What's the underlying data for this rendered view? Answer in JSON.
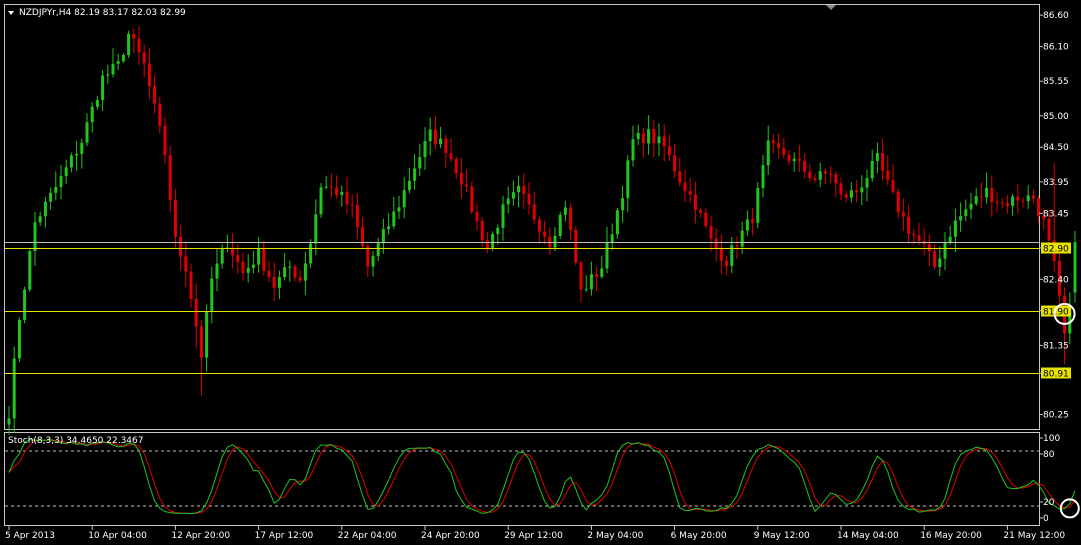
{
  "header": {
    "symbol_line": "NZDJPYr,H4  82.19 83.17 82.03 82.99",
    "indicator_line": "Stoch(8,3,3) 34.4650 22.3467"
  },
  "colors": {
    "background": "#000000",
    "bull": "#22C51E",
    "bear": "#E00000",
    "frame": "#C8C8C8",
    "level_line": "#E6E200",
    "bid_line": "#BEBEBE",
    "stoch_main": "#22C51E",
    "stoch_signal": "#E00000",
    "marker": "#FFFFFF",
    "arrow": "#22E21E"
  },
  "icons": [
    "dropdown-triangle-icon",
    "chart-shift-triangle-icon"
  ],
  "chart_data": [
    {
      "type": "candlestick",
      "symbol": "NZDJPYr",
      "timeframe": "H4",
      "last_bar": {
        "open": 82.19,
        "high": 83.17,
        "low": 82.03,
        "close": 82.99
      },
      "ylim": [
        80.1,
        86.65
      ],
      "y_ticks": [
        "86.60",
        "86.10",
        "85.55",
        "85.00",
        "84.50",
        "83.95",
        "83.45",
        "82.90",
        "82.40",
        "81.90",
        "81.35",
        "80.91",
        "80.25"
      ],
      "x_tick_labels": [
        "5 Apr 2013",
        "10 Apr 04:00",
        "12 Apr 20:00",
        "17 Apr 12:00",
        "22 Apr 04:00",
        "24 Apr 20:00",
        "29 Apr 12:00",
        "2 May 04:00",
        "6 May 20:00",
        "9 May 12:00",
        "14 May 04:00",
        "16 May 20:00",
        "21 May 12:00"
      ],
      "x_tick_bar_index": [
        0,
        16,
        32,
        48,
        64,
        80,
        96,
        112,
        128,
        144,
        160,
        176,
        192
      ],
      "horizontal_levels": [
        {
          "label": "82.90",
          "value": 82.9,
          "kind": "level"
        },
        {
          "label": "81.90",
          "value": 81.9,
          "kind": "level"
        },
        {
          "label": "80.91",
          "value": 80.91,
          "kind": "level"
        },
        {
          "label": "82.99",
          "value": 82.99,
          "kind": "bid"
        }
      ],
      "marker_circle": {
        "bar_index": 203,
        "value": 81.85
      },
      "anchors": [
        [
          0,
          80.3
        ],
        [
          2,
          81.8
        ],
        [
          5,
          83.3
        ],
        [
          10,
          84.0
        ],
        [
          14,
          84.6
        ],
        [
          18,
          85.6
        ],
        [
          21,
          85.8
        ],
        [
          23,
          86.3
        ],
        [
          26,
          85.8
        ],
        [
          30,
          84.4
        ],
        [
          32,
          83.0
        ],
        [
          34,
          82.6
        ],
        [
          37,
          81.2
        ],
        [
          39,
          82.4
        ],
        [
          42,
          83.0
        ],
        [
          45,
          82.5
        ],
        [
          48,
          82.8
        ],
        [
          51,
          82.3
        ],
        [
          54,
          82.6
        ],
        [
          56,
          82.4
        ],
        [
          58,
          83.0
        ],
        [
          60,
          83.9
        ],
        [
          63,
          83.8
        ],
        [
          66,
          83.5
        ],
        [
          69,
          82.6
        ],
        [
          72,
          83.1
        ],
        [
          75,
          83.6
        ],
        [
          78,
          84.2
        ],
        [
          81,
          84.7
        ],
        [
          84,
          84.5
        ],
        [
          87,
          84.0
        ],
        [
          90,
          83.3
        ],
        [
          92,
          82.9
        ],
        [
          95,
          83.5
        ],
        [
          98,
          83.8
        ],
        [
          101,
          83.4
        ],
        [
          104,
          83.0
        ],
        [
          107,
          83.6
        ],
        [
          110,
          82.2
        ],
        [
          112,
          82.4
        ],
        [
          114,
          82.6
        ],
        [
          116,
          83.2
        ],
        [
          118,
          83.8
        ],
        [
          120,
          84.6
        ],
        [
          123,
          84.7
        ],
        [
          126,
          84.5
        ],
        [
          129,
          84.0
        ],
        [
          132,
          83.6
        ],
        [
          135,
          83.0
        ],
        [
          138,
          82.7
        ],
        [
          140,
          83.0
        ],
        [
          143,
          83.4
        ],
        [
          146,
          84.5
        ],
        [
          149,
          84.4
        ],
        [
          152,
          84.2
        ],
        [
          155,
          84.0
        ],
        [
          158,
          84.1
        ],
        [
          160,
          83.7
        ],
        [
          163,
          83.8
        ],
        [
          167,
          84.3
        ],
        [
          170,
          83.7
        ],
        [
          173,
          83.2
        ],
        [
          176,
          82.9
        ],
        [
          178,
          82.6
        ],
        [
          180,
          83.0
        ],
        [
          182,
          83.3
        ],
        [
          185,
          83.6
        ],
        [
          188,
          83.8
        ],
        [
          191,
          83.6
        ],
        [
          194,
          83.7
        ],
        [
          197,
          83.7
        ],
        [
          199,
          83.3
        ],
        [
          201,
          82.6
        ],
        [
          203,
          81.5
        ],
        [
          205,
          82.19
        ]
      ],
      "stoch_panel": {
        "title": "Stoch(8,3,3)",
        "main_value": 34.465,
        "signal_value": 22.3467,
        "ylim": [
          0,
          100
        ],
        "y_ticks": [
          "100",
          "80",
          "20",
          "0"
        ],
        "levels": [
          80,
          20
        ],
        "marker_circle": {
          "bar_index": 204,
          "value": 12
        },
        "arrow": {
          "from": [
            210,
            5
          ],
          "to": [
            215,
            78
          ]
        }
      }
    }
  ]
}
